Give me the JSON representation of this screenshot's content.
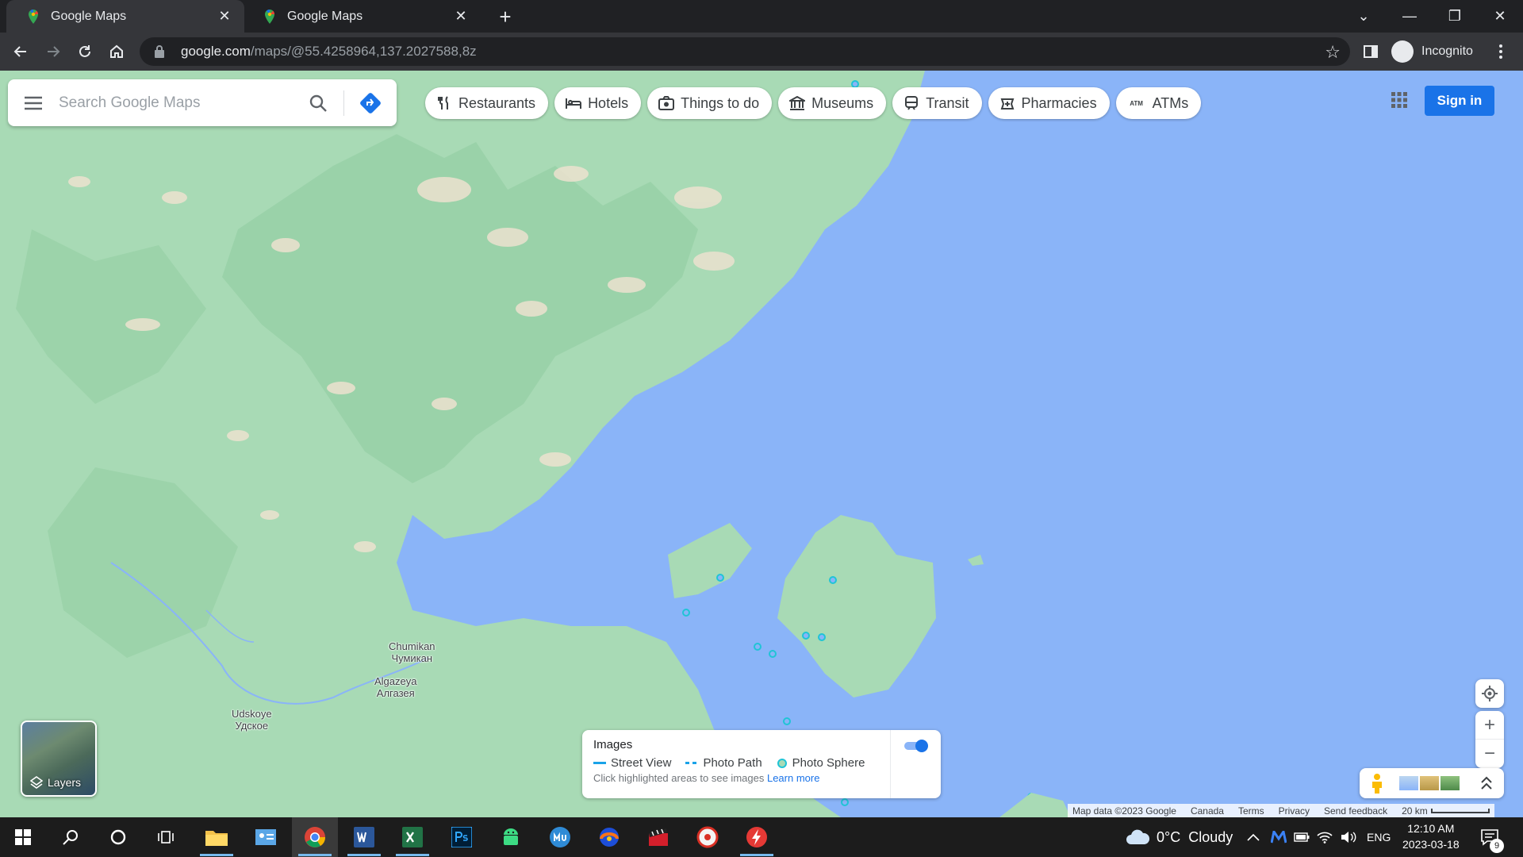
{
  "browser": {
    "tabs": [
      {
        "title": "Google Maps",
        "active": true
      },
      {
        "title": "Google Maps",
        "active": false
      }
    ],
    "url_host": "google.com",
    "url_path": "/maps/@55.4258964,137.2027588,8z",
    "profile_label": "Incognito"
  },
  "maps": {
    "search_placeholder": "Search Google Maps",
    "chips": [
      {
        "label": "Restaurants",
        "icon": "fork-knife-icon"
      },
      {
        "label": "Hotels",
        "icon": "bed-icon"
      },
      {
        "label": "Things to do",
        "icon": "camera-icon"
      },
      {
        "label": "Museums",
        "icon": "museum-icon"
      },
      {
        "label": "Transit",
        "icon": "train-icon"
      },
      {
        "label": "Pharmacies",
        "icon": "pharmacy-icon"
      },
      {
        "label": "ATMs",
        "icon": "atm-icon"
      }
    ],
    "atm_glyph": "ATM",
    "sign_in": "Sign in",
    "places": [
      {
        "name": "Chumikan",
        "native": "Чумикан"
      },
      {
        "name": "Algazeya",
        "native": "Алгазея"
      },
      {
        "name": "Udskoye",
        "native": "Удское"
      }
    ],
    "layers_label": "Layers",
    "images_panel": {
      "title": "Images",
      "legend": [
        "Street View",
        "Photo Path",
        "Photo Sphere"
      ],
      "hint": "Click highlighted areas to see images",
      "learn_more": "Learn more",
      "toggle_on": true
    },
    "footer": {
      "map_data": "Map data ©2023 Google",
      "country": "Canada",
      "terms": "Terms",
      "privacy": "Privacy",
      "feedback": "Send feedback",
      "scale": "20 km"
    },
    "colors": {
      "water": "#8ab4f8",
      "land": "#a8dab5",
      "accent": "#1a73e8"
    }
  },
  "taskbar": {
    "weather": "0°C  Cloudy",
    "language": "ENG",
    "time": "12:10 AM",
    "date": "2023-03-18",
    "notifications": "9"
  }
}
